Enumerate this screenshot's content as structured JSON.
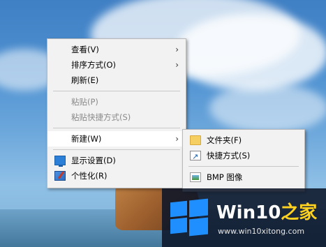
{
  "context_menu": {
    "items": [
      {
        "label": "查看(V)",
        "has_submenu": true,
        "enabled": true
      },
      {
        "label": "排序方式(O)",
        "has_submenu": true,
        "enabled": true
      },
      {
        "label": "刷新(E)",
        "has_submenu": false,
        "enabled": true
      },
      {
        "label": "粘贴(P)",
        "has_submenu": false,
        "enabled": false
      },
      {
        "label": "粘贴快捷方式(S)",
        "has_submenu": false,
        "enabled": false
      },
      {
        "label": "新建(W)",
        "has_submenu": true,
        "enabled": true,
        "highlighted": true
      },
      {
        "label": "显示设置(D)",
        "icon": "display-settings-icon",
        "enabled": true
      },
      {
        "label": "个性化(R)",
        "icon": "personalize-icon",
        "enabled": true
      }
    ],
    "arrow_glyph": "›"
  },
  "new_submenu": {
    "items": [
      {
        "label": "文件夹(F)",
        "icon": "folder-icon"
      },
      {
        "label": "快捷方式(S)",
        "icon": "shortcut-icon"
      },
      {
        "label": "BMP 图像",
        "icon": "bmp-image-icon"
      }
    ]
  },
  "watermark": {
    "title_main": "Win10",
    "title_accent": "之家",
    "url": "www.win10xitong.com"
  },
  "colors": {
    "menu_bg": "#f2f2f2",
    "menu_highlight": "#ffffff",
    "disabled_text": "#8a8a8a",
    "watermark_accent": "#ffd21f",
    "logo_blue": "#1f8fff"
  }
}
